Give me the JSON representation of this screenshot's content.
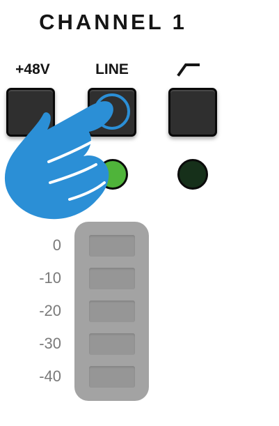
{
  "channel": {
    "title": "CHANNEL 1"
  },
  "buttons": {
    "phantom_power": {
      "label": "+48V",
      "state": "off"
    },
    "line": {
      "label": "LINE",
      "state": "pressed"
    },
    "high_pass_filter": {
      "label_icon": "high-pass-filter-icon",
      "state": "off"
    }
  },
  "leds": {
    "line": {
      "state": "on",
      "color": "#4fb43a"
    },
    "high_pass_filter": {
      "state": "off",
      "color": "#16301a"
    }
  },
  "meter": {
    "labels": [
      "0",
      "-10",
      "-20",
      "-30",
      "-40"
    ],
    "segment_color": "#969696",
    "background_color": "#a3a3a3"
  },
  "pointer": {
    "icon": "hand-pointer-icon",
    "color": "#2b8fd6",
    "target": "line-button"
  }
}
